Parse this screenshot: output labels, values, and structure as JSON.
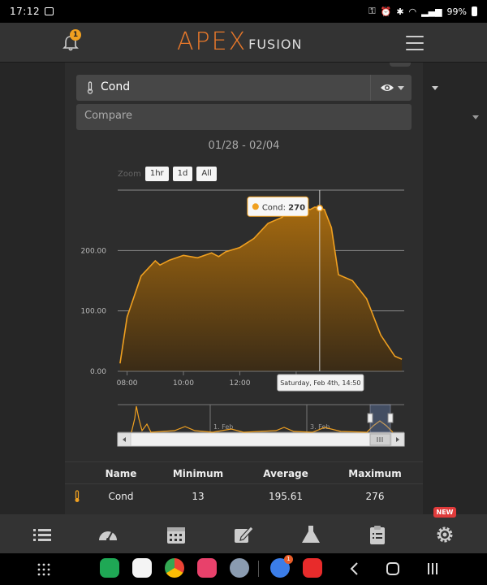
{
  "status_bar": {
    "time": "17:12",
    "battery": "99%"
  },
  "header": {
    "logo_main": "APEX",
    "logo_sub": "FUSION",
    "notification_count": "1"
  },
  "selector": {
    "probe": "Cond",
    "compare_placeholder": "Compare"
  },
  "date_range": "01/28 - 02/04",
  "zoom": {
    "label": "Zoom",
    "options": [
      "1hr",
      "1d",
      "All"
    ]
  },
  "tooltip": {
    "series": "Cond",
    "value": "270",
    "date": "Saturday, Feb 4th, 14:50"
  },
  "navigator": {
    "labels": [
      "1. Feb",
      "3. Feb"
    ]
  },
  "chart_data": {
    "type": "area",
    "series": [
      {
        "name": "Cond",
        "x": [
          "07:45",
          "08:00",
          "08:30",
          "09:00",
          "09:10",
          "09:30",
          "10:00",
          "10:30",
          "11:00",
          "11:15",
          "11:30",
          "12:00",
          "12:30",
          "13:00",
          "13:30",
          "13:45",
          "14:00",
          "14:30",
          "14:40",
          "14:50",
          "15:00",
          "15:15",
          "15:30",
          "16:00",
          "16:30",
          "17:00",
          "17:30",
          "17:45"
        ],
        "values": [
          13,
          90,
          158,
          183,
          176,
          184,
          192,
          188,
          196,
          190,
          198,
          205,
          220,
          245,
          255,
          267,
          272,
          268,
          272,
          270,
          268,
          238,
          160,
          150,
          120,
          60,
          25,
          20
        ]
      }
    ],
    "xlabel": "",
    "ylabel": "",
    "x_ticks": [
      "08:00",
      "10:00",
      "12:00",
      "14:00"
    ],
    "y_ticks": [
      "0.00",
      "100.00",
      "200.00"
    ],
    "ylim": [
      0,
      300
    ],
    "grid": true,
    "legend": "none"
  },
  "stats": {
    "columns": [
      "Name",
      "Minimum",
      "Average",
      "Maximum"
    ],
    "rows": [
      {
        "name": "Cond",
        "minimum": "13",
        "average": "195.61",
        "maximum": "276"
      }
    ]
  },
  "bottom_nav": {
    "badge": "NEW"
  },
  "colors": {
    "accent": "#f0a020",
    "brand": "#e8782a",
    "panel": "#2d2d2d"
  }
}
